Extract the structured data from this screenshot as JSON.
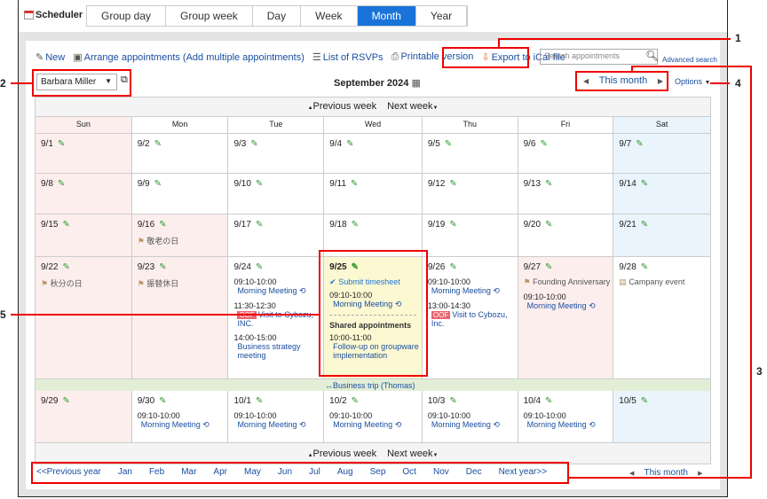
{
  "app": {
    "title": "Scheduler"
  },
  "tabs": [
    {
      "label": "Group day"
    },
    {
      "label": "Group week"
    },
    {
      "label": "Day"
    },
    {
      "label": "Week"
    },
    {
      "label": "Month",
      "active": true
    },
    {
      "label": "Year"
    }
  ],
  "toolbar": {
    "new": "New",
    "arrange": "Arrange appointments (Add multiple appointments)",
    "rsvps": "List of RSVPs",
    "print": "Printable version",
    "export": "Export to iCal file"
  },
  "search": {
    "placeholder": "Search appointments",
    "advanced": "Advanced search"
  },
  "user_select": {
    "value": "Barbara Miller"
  },
  "month_title": "September 2024",
  "nav": {
    "this_month": "This month",
    "options": "Options"
  },
  "week_nav": {
    "prev": "Previous week",
    "next": "Next week"
  },
  "day_headers": [
    "Sun",
    "Mon",
    "Tue",
    "Wed",
    "Thu",
    "Fri",
    "Sat"
  ],
  "weeks": [
    [
      {
        "d": "9/1"
      },
      {
        "d": "9/2"
      },
      {
        "d": "9/3"
      },
      {
        "d": "9/4"
      },
      {
        "d": "9/5"
      },
      {
        "d": "9/6"
      },
      {
        "d": "9/7"
      }
    ],
    [
      {
        "d": "9/8"
      },
      {
        "d": "9/9"
      },
      {
        "d": "9/10"
      },
      {
        "d": "9/11"
      },
      {
        "d": "9/12"
      },
      {
        "d": "9/13"
      },
      {
        "d": "9/14"
      }
    ],
    [
      {
        "d": "9/15"
      },
      {
        "d": "9/16",
        "holiday": "敬老の日"
      },
      {
        "d": "9/17"
      },
      {
        "d": "9/18"
      },
      {
        "d": "9/19"
      },
      {
        "d": "9/20"
      },
      {
        "d": "9/21"
      }
    ],
    [
      {
        "d": "9/22",
        "holiday": "秋分の日"
      },
      {
        "d": "9/23",
        "holiday": "振替休日"
      },
      {
        "d": "9/24",
        "events": [
          {
            "time": "09:10-10:00",
            "title": "Morning Meeting",
            "repeat": true
          },
          {
            "time": "11:30-12:30",
            "title": "Visit to Cybozu, INC.",
            "oof": "OOF"
          },
          {
            "time": "14:00-15:00",
            "title": "Business strategy meeting"
          }
        ]
      },
      {
        "d": "9/25",
        "today": true,
        "todo": "Submit timesheet",
        "events": [
          {
            "time": "09:10-10:00",
            "title": "Morning Meeting",
            "repeat": true
          }
        ],
        "shared_label": "Shared appointments",
        "shared": [
          {
            "time": "10:00-11:00",
            "title": "Follow-up on groupware implementation"
          }
        ]
      },
      {
        "d": "9/26",
        "events": [
          {
            "time": "09:10-10:00",
            "title": "Morning Meeting",
            "repeat": true
          },
          {
            "time": "13:00-14:30",
            "title": "Visit to Cybozu, Inc.",
            "oof": "OOF"
          }
        ]
      },
      {
        "d": "9/27",
        "holiday": "Founding Anniversary",
        "events": [
          {
            "time": "09:10-10:00",
            "title": "Morning Meeting",
            "repeat": true
          }
        ]
      },
      {
        "d": "9/28",
        "company_event": "Campany event"
      }
    ],
    [
      {
        "d": "9/29"
      },
      {
        "d": "9/30",
        "events": [
          {
            "time": "09:10-10:00",
            "title": "Morning Meeting",
            "repeat": true
          }
        ]
      },
      {
        "d": "10/1",
        "events": [
          {
            "time": "09:10-10:00",
            "title": "Morning Meeting",
            "repeat": true
          }
        ]
      },
      {
        "d": "10/2",
        "events": [
          {
            "time": "09:10-10:00",
            "title": "Morning Meeting",
            "repeat": true
          }
        ]
      },
      {
        "d": "10/3",
        "events": [
          {
            "time": "09:10-10:00",
            "title": "Morning Meeting",
            "repeat": true
          }
        ]
      },
      {
        "d": "10/4",
        "events": [
          {
            "time": "09:10-10:00",
            "title": "Morning Meeting",
            "repeat": true
          }
        ]
      },
      {
        "d": "10/5"
      }
    ]
  ],
  "banner": "Business trip (Thomas)",
  "month_links": [
    "<<Previous year",
    "Jan",
    "Feb",
    "Mar",
    "Apr",
    "May",
    "Jun",
    "Jul",
    "Aug",
    "Sep",
    "Oct",
    "Nov",
    "Dec",
    "Next year>>"
  ],
  "bottom_nav": {
    "this_month": "This month"
  },
  "callouts": [
    "1",
    "2",
    "3",
    "4",
    "5"
  ],
  "colors": {
    "accent": "#1a73d9",
    "holiday_bg": "#fdeeee",
    "saturday_bg": "#eaf4fc",
    "today_bg": "#fcf8d2",
    "trip_bg": "#e2efd6",
    "callout": "#e00000"
  }
}
